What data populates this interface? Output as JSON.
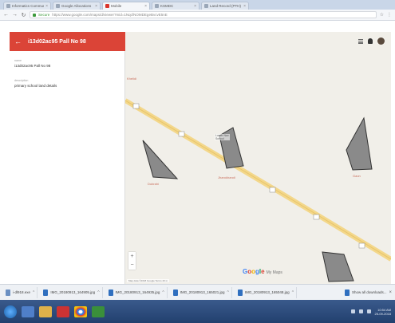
{
  "browser": {
    "tabs": [
      {
        "label": "Informatics Community",
        "active": false
      },
      {
        "label": "Google Allocations",
        "active": false
      },
      {
        "label": "Mobile",
        "active": true
      },
      {
        "label": "KSMDC",
        "active": false
      },
      {
        "label": "Land Record (PTH)",
        "active": false
      }
    ],
    "secure_label": "Secure",
    "url": "https://www.google.com/maps/d/viewer?mid=1NqcfNOMDEgeBvcvE5nE"
  },
  "app": {
    "title": "i13d02ac95 Pall No 98",
    "fields": [
      {
        "label": "name",
        "value": "i13d02ac95 Pall No 98"
      },
      {
        "label": "description",
        "value": "primary school land details"
      }
    ]
  },
  "map": {
    "labels": {
      "left_top": "Khelidi",
      "landmark": "Lower Nav\nSchool",
      "area1": "Dubrahi",
      "area2": "Jharokhandi",
      "area3": "Gaon"
    },
    "shield_labels": [
      "NH",
      "NH",
      "NH",
      "NH",
      "NH"
    ],
    "brand": "Google",
    "brand_suffix": "My Maps",
    "attribution": "Map data ©2018 Google   Terms   20 m",
    "colors": {
      "road": "#f3d78a",
      "parcel_fill": "#8a8a8a",
      "parcel_stroke": "#333333",
      "header": "#db4437"
    }
  },
  "downloads": {
    "items": [
      {
        "label": "i-dl918.exe"
      },
      {
        "label": "IMG_20180913_164905.jpg"
      },
      {
        "label": "IMG_20180913_164935.jpg"
      },
      {
        "label": "IMG_20180913_165021.jpg"
      },
      {
        "label": "IMG_20180913_165048.jpg"
      }
    ],
    "show_all": "Show all downloads...",
    "close": "×"
  },
  "taskbar": {
    "time": "10:54 AM",
    "date": "25-09-2018"
  }
}
